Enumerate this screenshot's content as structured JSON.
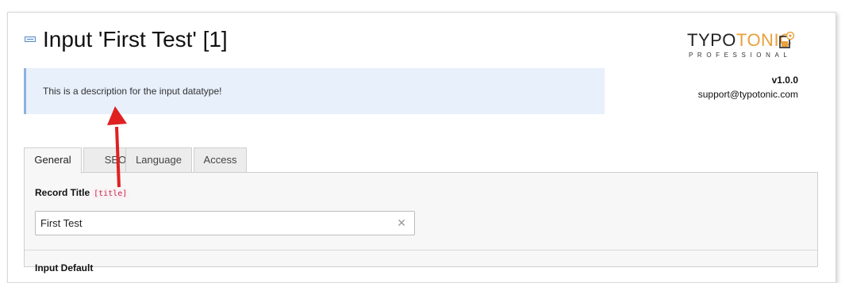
{
  "header": {
    "title": "Input 'First Test' [1]",
    "description": "This is a description for the input datatype!"
  },
  "branding": {
    "logo_typo": "TYPO",
    "logo_tonic": "TONIC",
    "logo_subtitle": "PROFESSIONAL",
    "version": "v1.0.0",
    "support_email": "support@typotonic.com",
    "accent_color": "#e8a13c"
  },
  "tabs": [
    {
      "label": "General",
      "active": true
    },
    {
      "label": "SEO",
      "active": false
    },
    {
      "label": "Language",
      "active": false
    },
    {
      "label": "Access",
      "active": false
    }
  ],
  "fields": {
    "record_title": {
      "label": "Record Title",
      "code": "[title]",
      "value": "First Test"
    },
    "next_label": "Input Default"
  },
  "annotation": {
    "arrow_color": "#e02020"
  }
}
